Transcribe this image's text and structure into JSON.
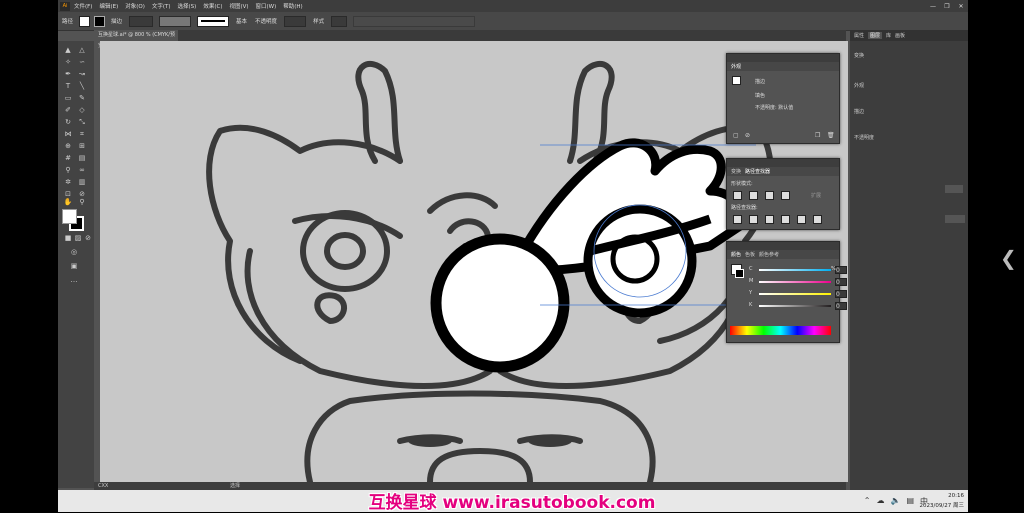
{
  "menubar": {
    "logo": "Ai",
    "items": [
      "文件(F)",
      "编辑(E)",
      "对象(O)",
      "文字(T)",
      "选择(S)",
      "效果(C)",
      "视图(V)",
      "窗口(W)",
      "帮助(H)"
    ],
    "window_controls": [
      "—",
      "❐",
      "✕"
    ]
  },
  "control": {
    "path_label": "路径",
    "stroke_label": "描边",
    "stroke_style": "基本",
    "opacity_label": "不透明度",
    "style_label": "样式"
  },
  "document": {
    "tab_title": "互换星球.ai* @ 800 % (CMYK/预览)",
    "zoom": "CXX",
    "status_tool": "选择"
  },
  "right_panel": {
    "tabs": [
      "属性",
      "图层",
      "库",
      "画板"
    ],
    "active_tab": "图层",
    "rows": [
      "变换",
      "外观",
      "描边",
      "不透明度"
    ]
  },
  "appearance_panel": {
    "title": "外观",
    "rows": [
      "描边",
      "填色",
      "不透明度: 默认值"
    ],
    "icon_names": [
      "add-icon",
      "clear-icon",
      "duplicate-icon",
      "delete-icon"
    ]
  },
  "pathfinder_panel": {
    "tabs": [
      "变换",
      "路径查找器"
    ],
    "active_tab": "路径查找器",
    "shape_modes_label": "形状模式:",
    "pathfinders_label": "路径查找器:",
    "expand_label": "扩展"
  },
  "color_panel": {
    "tabs": [
      "颜色",
      "色板",
      "颜色参考"
    ],
    "active_tab": "颜色",
    "channels": [
      {
        "name": "C",
        "value": "0",
        "color": "#00aeef"
      },
      {
        "name": "M",
        "value": "0",
        "color": "#ec008c"
      },
      {
        "name": "Y",
        "value": "0",
        "color": "#fff200"
      },
      {
        "name": "K",
        "value": "0",
        "color": "#231f20"
      }
    ],
    "unit": "%"
  },
  "taskbar": {
    "time": "20:16",
    "date": "2023/09/27 周三",
    "tray_icons": [
      "chevron-up-icon",
      "cloud-icon",
      "speaker-icon",
      "network-icon",
      "ime-icon"
    ]
  },
  "watermark": "互换星球 www.irasutobook.com",
  "colors": {
    "canvas": "#c8c8c8",
    "panel_bg": "#535353",
    "watermark": "#e4007f"
  }
}
